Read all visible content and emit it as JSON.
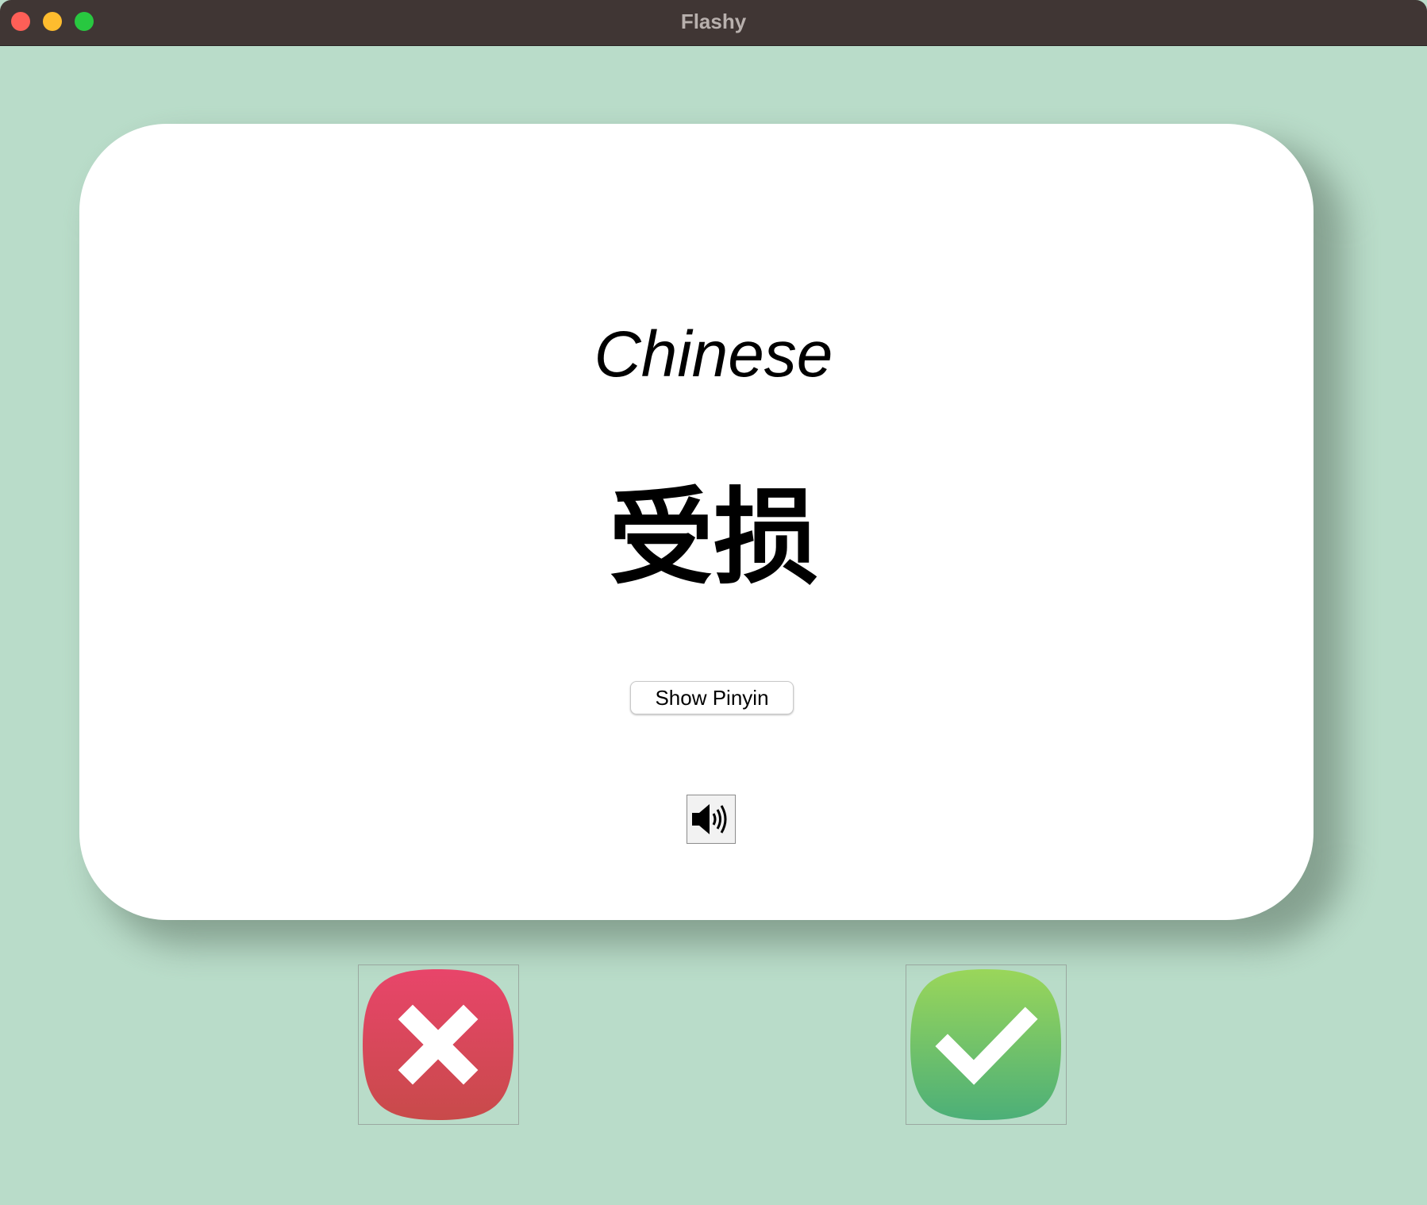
{
  "window": {
    "title": "Flashy"
  },
  "card": {
    "language": "Chinese",
    "word": "受损",
    "show_pinyin_label": "Show Pinyin"
  },
  "icons": {
    "speaker": "speaker-icon",
    "wrong": "cross-icon",
    "right": "checkmark-icon"
  },
  "colors": {
    "background": "#b9dcc9",
    "card": "#ffffff",
    "wrong_top": "#e8456a",
    "wrong_bottom": "#c84a4a",
    "right_top": "#9ad65a",
    "right_bottom": "#4caf78"
  }
}
